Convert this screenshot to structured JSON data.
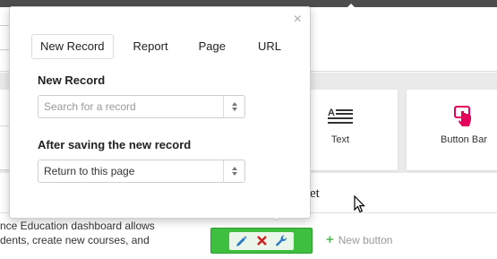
{
  "background": {
    "left_input_value": "is",
    "widgets": [
      {
        "label": "Text",
        "icon": "text-lines-icon"
      },
      {
        "label": "Button Bar",
        "icon": "hand-pointer-icon"
      }
    ],
    "widget_heading_tail": "et",
    "body_lines": [
      "nce Education dashboard allows",
      "dents, create new courses, and"
    ],
    "new_button_label": "New button",
    "accent_green": "#3fbf3f",
    "pink": "#e5005c"
  },
  "popover": {
    "tabs": [
      {
        "label": "New Record",
        "active": true
      },
      {
        "label": "Report",
        "active": false
      },
      {
        "label": "Page",
        "active": false
      },
      {
        "label": "URL",
        "active": false
      }
    ],
    "record_label": "New Record",
    "record_placeholder": "Search for a record",
    "after_label": "After saving the new record",
    "after_value": "Return to this page",
    "close_glyph": "×"
  }
}
